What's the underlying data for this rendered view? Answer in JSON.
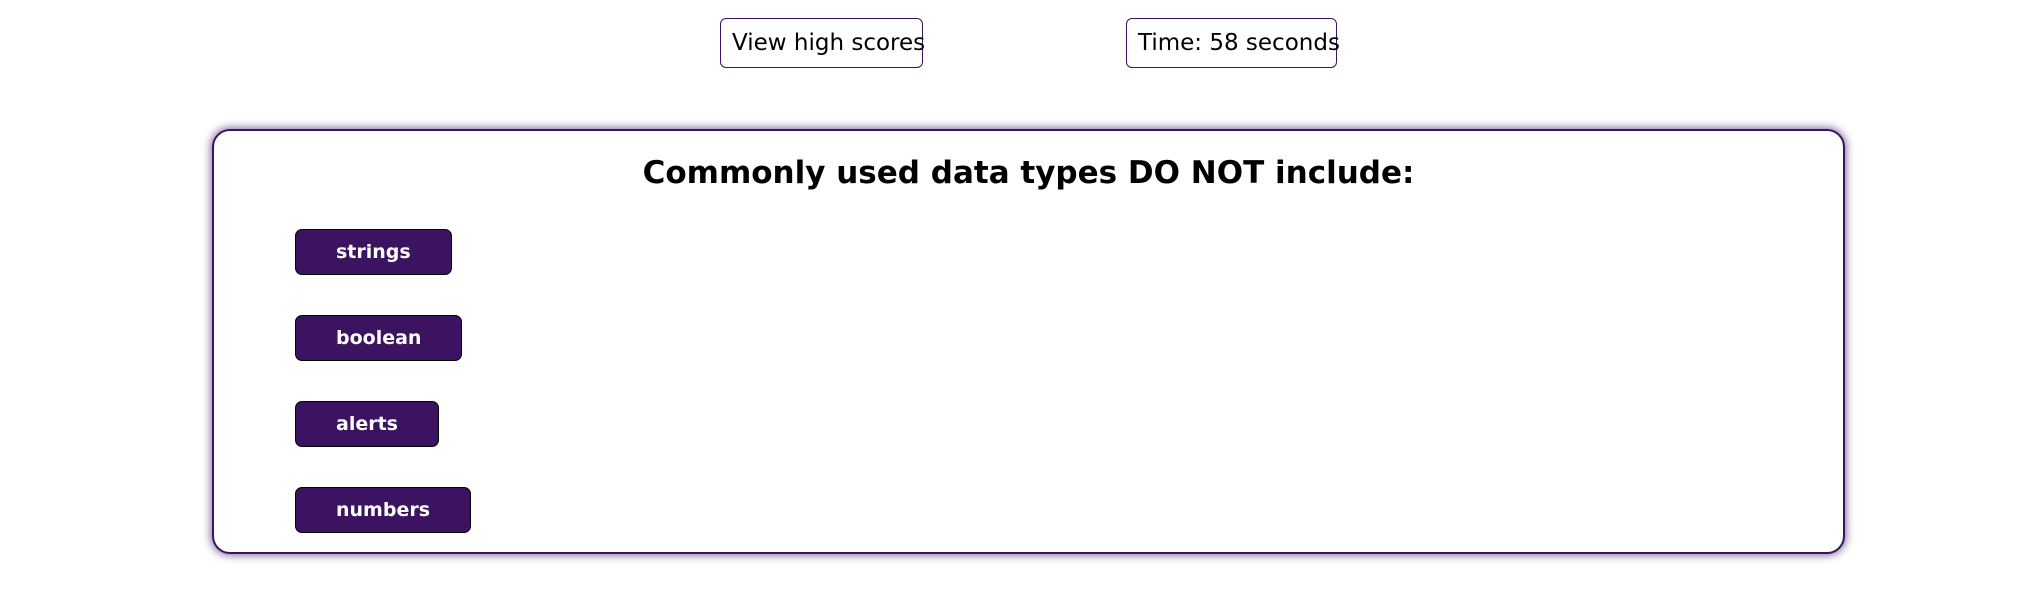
{
  "header": {
    "high_scores_label": "View high scores",
    "timer_text": "Time: 58 seconds"
  },
  "quiz": {
    "question": "Commonly used data types DO NOT include:",
    "answers": [
      {
        "label": "strings"
      },
      {
        "label": "boolean"
      },
      {
        "label": "alerts"
      },
      {
        "label": "numbers"
      }
    ]
  },
  "colors": {
    "accent": "#3b1361",
    "button_text": "#ffffff",
    "background": "#ffffff"
  }
}
